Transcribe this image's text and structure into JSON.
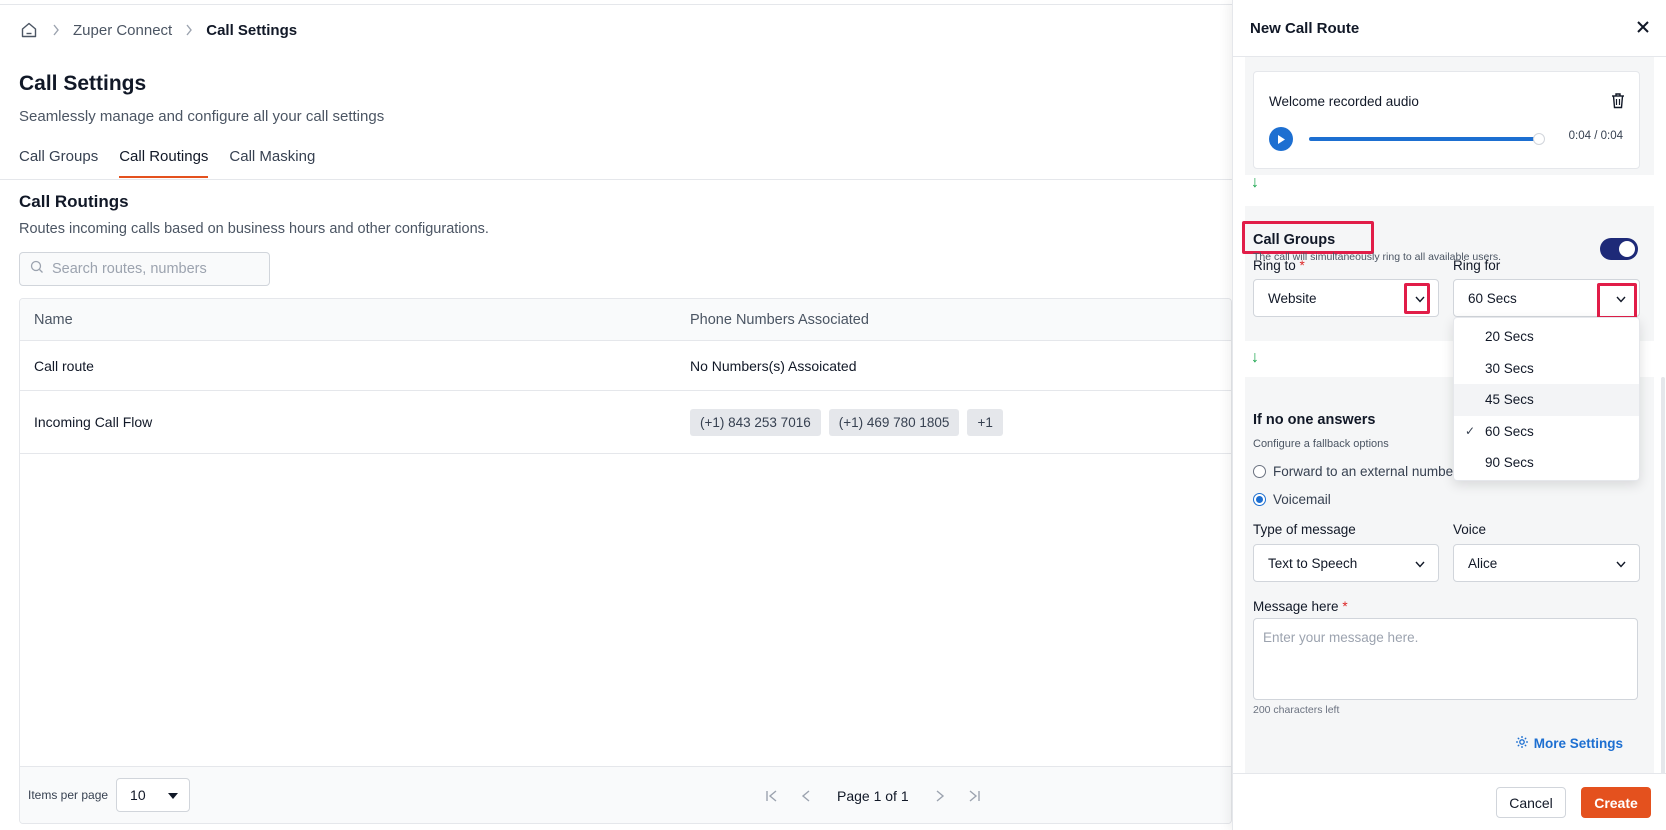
{
  "breadcrumb": {
    "items": [
      "Zuper Connect",
      "Call Settings"
    ]
  },
  "page": {
    "title": "Call Settings",
    "subtitle": "Seamlessly manage and configure all your call settings"
  },
  "tabs": [
    {
      "label": "Call Groups",
      "active": false
    },
    {
      "label": "Call Routings",
      "active": true
    },
    {
      "label": "Call Masking",
      "active": false
    }
  ],
  "section": {
    "title": "Call Routings",
    "description": "Routes incoming calls based on business hours and other configurations."
  },
  "search": {
    "placeholder": "Search routes, numbers",
    "value": ""
  },
  "table": {
    "columns": [
      "Name",
      "Phone Numbers Associated"
    ],
    "rows": [
      {
        "name": "Call route",
        "phone_text": "No Numbers(s) Assoicated",
        "chips": []
      },
      {
        "name": "Incoming Call Flow",
        "phone_text": "",
        "chips": [
          "(+1) 843 253 7016",
          "(+1) 469 780 1805",
          "+1"
        ]
      }
    ]
  },
  "pagination": {
    "items_per_page_label": "Items per page",
    "items_per_page": "10",
    "page_label": "Page 1 of 1"
  },
  "drawer": {
    "title": "New Call Route",
    "audio": {
      "title": "Welcome recorded audio",
      "time": "0:04 / 0:04",
      "progress_fraction": 1.0
    },
    "call_groups": {
      "title": "Call Groups",
      "description": "The call will simultaneously ring to all available users.",
      "enabled": true,
      "ring_to_label": "Ring to",
      "ring_to_value": "Website",
      "ring_for_label": "Ring for",
      "ring_for_value": "60 Secs",
      "ring_for_options": [
        "20 Secs",
        "30 Secs",
        "45 Secs",
        "60 Secs",
        "90 Secs"
      ],
      "ring_for_selected": "60 Secs",
      "ring_for_hovered": "45 Secs"
    },
    "no_answer": {
      "title": "If no one answers",
      "description": "Configure a fallback options",
      "options": [
        "Forward to an external number",
        "Voicemail"
      ],
      "selected": "Voicemail",
      "type_label": "Type of message",
      "type_value": "Text to Speech",
      "voice_label": "Voice",
      "voice_value": "Alice",
      "message_label": "Message here",
      "message_placeholder": "Enter your message here.",
      "chars_left": "200 characters left",
      "more_settings": "More Settings"
    },
    "footer": {
      "cancel": "Cancel",
      "create": "Create"
    }
  },
  "colors": {
    "accent": "#e4511e",
    "link": "#1d6fd1",
    "toggle": "#1e2a78",
    "highlight": "#e11d48"
  }
}
